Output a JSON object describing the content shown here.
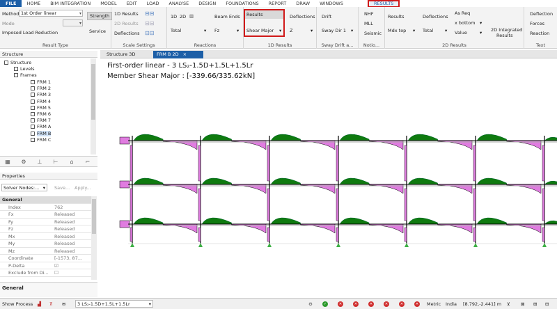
{
  "menu": {
    "items": [
      "FILE",
      "HOME",
      "BIM INTEGRATION",
      "MODEL",
      "EDIT",
      "LOAD",
      "ANALYSE",
      "DESIGN",
      "FOUNDATIONS",
      "REPORT",
      "DRAW",
      "WINDOWS",
      "RESULTS"
    ],
    "active": "RESULTS"
  },
  "ribbon": {
    "result_type": {
      "method_label": "Method",
      "method_value": "1st Order linear",
      "mode_label": "Mode",
      "imposed": "Imposed Load Reduction",
      "strength": "Strength",
      "service": "Service",
      "group": "Result Type"
    },
    "scale": {
      "r1d": "1D Results",
      "r2d": "2D Results",
      "defl": "Deflections",
      "group": "Scale Settings"
    },
    "reactions": {
      "v1d": "1D",
      "v2d": "2D",
      "total": "Total",
      "beam_ends": "Beam Ends",
      "fz": "Fz",
      "group": "Reactions"
    },
    "results1d": {
      "results": "Results",
      "shear_major": "Shear Major",
      "deflections": "Deflections",
      "z": "Z",
      "group": "1D Results"
    },
    "sway": {
      "drift": "Drift",
      "sway_dir": "Sway Dir 1",
      "group": "Sway Drift a..."
    },
    "notional": {
      "nhf": "NHF",
      "mll": "MLL",
      "seismic": "Seismic",
      "group": "Notio..."
    },
    "results2d": {
      "results": "Results",
      "mdx_top": "Mdx top",
      "deflections": "Deflections",
      "total": "Total",
      "as_req": "As Req",
      "x_bottom": "x bottom",
      "value": "Value",
      "integrated": "2D Integrated",
      "integrated2": "Results",
      "group": "2D Results"
    },
    "text": {
      "deflection": "Deflection",
      "forces": "Forces",
      "reaction": "Reaction",
      "group": "Text"
    }
  },
  "structure_panel": {
    "title": "Structure",
    "root": "Structure",
    "levels": "Levels",
    "frames": "Frames",
    "frames_list": [
      "FRM 1",
      "FRM 2",
      "FRM 3",
      "FRM 4",
      "FRM 5",
      "FRM 6",
      "FRM 7",
      "FRM A",
      "FRM B",
      "FRM C"
    ],
    "selected": "FRM B"
  },
  "tabs": [
    {
      "label": "Structure 3D"
    },
    {
      "label": "FRM B 2D"
    }
  ],
  "canvas": {
    "line1": "First-order linear - 3 LS₂-1.5D+1.5L+1.5Lr",
    "line2": "Member Shear Major : [-339.66/335.62kN]"
  },
  "properties": {
    "title": "Properties",
    "selector": "Solver Nodes:...",
    "save": "Save...",
    "apply": "Apply...",
    "section": "General",
    "rows": [
      {
        "k": "Index",
        "v": "762"
      },
      {
        "k": "Fx",
        "v": "Released"
      },
      {
        "k": "Fy",
        "v": "Released"
      },
      {
        "k": "Fz",
        "v": "Released"
      },
      {
        "k": "Mx",
        "v": "Released"
      },
      {
        "k": "My",
        "v": "Released"
      },
      {
        "k": "Mz",
        "v": "Released"
      },
      {
        "k": "Coordinate",
        "v": "[-1573, 87..."
      },
      {
        "k": "P-Delta",
        "v": "☑"
      },
      {
        "k": "Exclude from Di...",
        "v": "☐"
      }
    ],
    "footer": "General"
  },
  "status": {
    "show_process": "Show Process",
    "combo": "3 LS₂-1.5D+1.5L+1.5Lr",
    "units": "Metric",
    "region": "India",
    "coords": "[8.792,-2.441] m"
  },
  "colors": {
    "accent": "#1d5fa7",
    "positive": "#0f7a0f",
    "negative": "#e07ce0",
    "highlight": "#d01919"
  }
}
